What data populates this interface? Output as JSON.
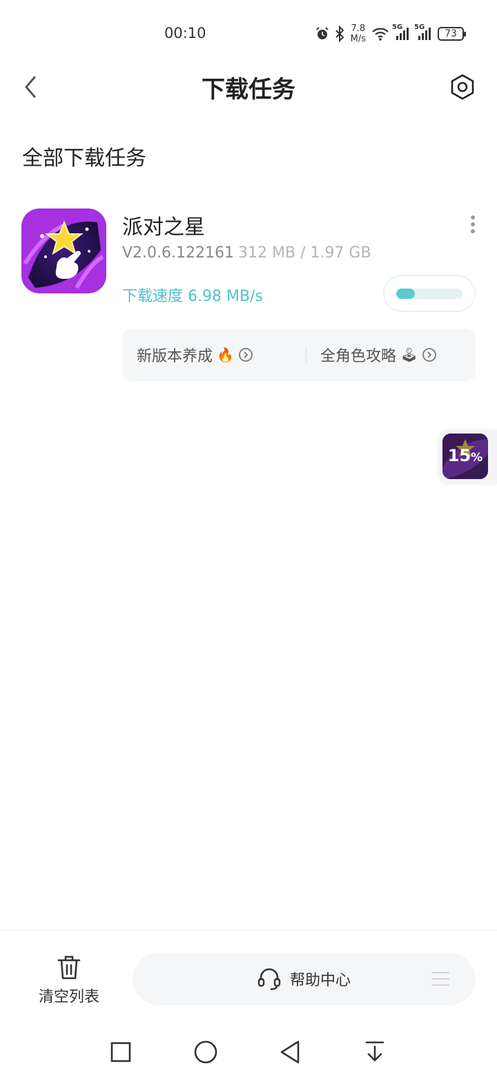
{
  "status_bar": {
    "time": "00:10",
    "net_speed_value": "7.8",
    "net_speed_unit": "M/s",
    "signal1_label": "5G",
    "signal2_label": "5G",
    "battery": "73"
  },
  "header": {
    "title": "下载任务"
  },
  "section": {
    "title": "全部下载任务"
  },
  "task": {
    "name": "派对之星",
    "version": "V2.0.6.122161",
    "size": "312 MB / 1.97 GB",
    "speed": "下载速度 6.98 MB/s",
    "progress_fraction": 0.28,
    "promo1": "新版本养成",
    "promo1_emoji": "🔥",
    "promo2": "全角色攻略",
    "promo2_emoji": "🕹"
  },
  "floating_badge": {
    "percent_value": "15",
    "percent_sign": "%"
  },
  "bottom": {
    "clear_label": "清空列表",
    "help_label": "帮助中心"
  },
  "colors": {
    "accent": "#4fc1c8",
    "progress_fill": "#5ccad0",
    "app_icon_purple": "#8a2bd6"
  },
  "icons": {
    "status": [
      "alarm-icon",
      "bluetooth-icon",
      "wifi-icon",
      "signal-icon",
      "battery-icon"
    ],
    "header": [
      "back-arrow-icon",
      "settings-icon"
    ],
    "task": [
      "more-icon",
      "arrow-circle-icon"
    ],
    "bottom": [
      "trash-icon",
      "headset-icon",
      "menu-icon"
    ],
    "nav": [
      "square-icon",
      "circle-icon",
      "triangle-back-icon",
      "download-icon"
    ]
  }
}
